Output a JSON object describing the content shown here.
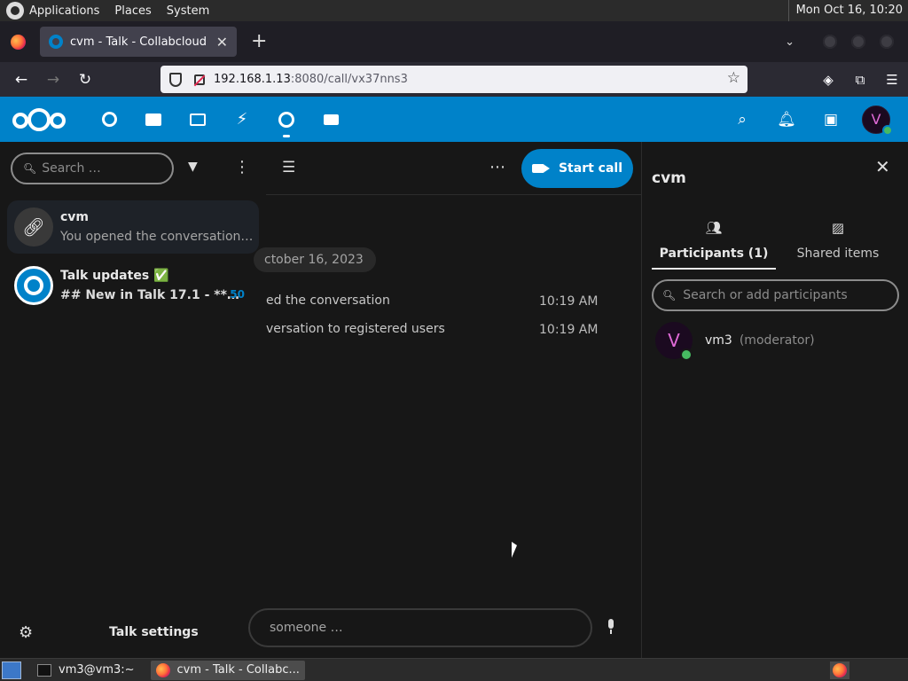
{
  "gnome_panel": {
    "menus": [
      "Applications",
      "Places",
      "System"
    ],
    "clock": "Mon Oct 16, 10:20"
  },
  "browser": {
    "tab_title": "cvm - Talk - Collabcloud",
    "url_host": "192.168.1.13",
    "url_rest": ":8080/call/vx37nns3"
  },
  "left_sidebar": {
    "search_placeholder": "Search …",
    "conversations": [
      {
        "name": "cvm",
        "subtitle": "You opened the conversation t…",
        "avatar_icon": "link-icon"
      },
      {
        "name": "Talk updates ✅",
        "subtitle": "## New in Talk 17.1 - **…",
        "unread": "50",
        "avatar_icon": "talk-icon"
      }
    ],
    "settings_label": "Talk settings"
  },
  "chat": {
    "start_call_label": "Start call",
    "date_separator": "ctober 16, 2023",
    "messages": [
      {
        "text": "ed the conversation",
        "time": "10:19 AM"
      },
      {
        "text": "versation to registered users",
        "time": "10:19 AM"
      }
    ],
    "composer_placeholder": "someone …"
  },
  "right_sidebar": {
    "title": "cvm",
    "tabs": [
      {
        "label": "Participants (1)",
        "active": true
      },
      {
        "label": "Shared items",
        "active": false
      }
    ],
    "search_placeholder": "Search or add participants",
    "participants": [
      {
        "name": "vm3",
        "role": "(moderator)",
        "initial": "V"
      }
    ]
  },
  "header": {
    "user_initial": "V"
  },
  "taskbar": {
    "tasks": [
      {
        "label": "vm3@vm3:~"
      },
      {
        "label": "cvm - Talk - Collabc..."
      }
    ]
  },
  "colors": {
    "accent": "#0082c9",
    "online": "#46ba61",
    "background": "#171717"
  }
}
